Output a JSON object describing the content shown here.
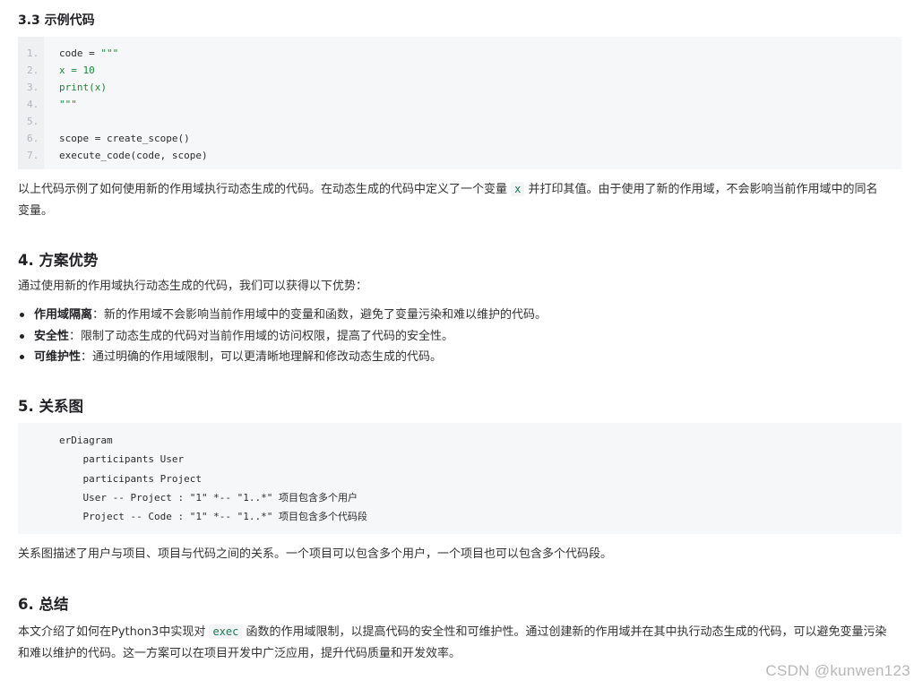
{
  "sections": {
    "s33_title": "3.3 示例代码",
    "code1": [
      {
        "n": "1.",
        "segments": [
          {
            "t": "code = ",
            "c": "plain"
          },
          {
            "t": "\"\"\"",
            "c": "str"
          }
        ]
      },
      {
        "n": "2.",
        "segments": [
          {
            "t": "x = 10",
            "c": "str"
          }
        ]
      },
      {
        "n": "3.",
        "segments": [
          {
            "t": "print(x)",
            "c": "str"
          }
        ]
      },
      {
        "n": "4.",
        "segments": [
          {
            "t": "\"\"\"",
            "c": "str"
          }
        ]
      },
      {
        "n": "5.",
        "segments": []
      },
      {
        "n": "6.",
        "segments": [
          {
            "t": "scope = create_scope()",
            "c": "plain"
          }
        ]
      },
      {
        "n": "7.",
        "segments": [
          {
            "t": "execute_code(code, scope)",
            "c": "plain"
          }
        ]
      }
    ],
    "explain_before": "以上代码示例了如何使用新的作用域执行动态生成的代码。在动态生成的代码中定义了一个变量 ",
    "explain_code": "x",
    "explain_after_line1": " 并打印其值。由于使用了新的作用域，不会影响当前作用域中的同名",
    "explain_line2": "变量。",
    "s4_title": "4. 方案优势",
    "s4_intro": "通过使用新的作用域执行动态生成的代码，我们可以获得以下优势：",
    "benefits": [
      {
        "term": "作用域隔离",
        "desc": "：新的作用域不会影响当前作用域中的变量和函数，避免了变量污染和难以维护的代码。"
      },
      {
        "term": "安全性",
        "desc": "：限制了动态生成的代码对当前作用域的访问权限，提高了代码的安全性。"
      },
      {
        "term": "可维护性",
        "desc": "：通过明确的作用域限制，可以更清晰地理解和修改动态生成的代码。"
      }
    ],
    "s5_title": "5. 关系图",
    "er_lines": [
      "erDiagram",
      "    participants User",
      "    participants Project",
      "    User -- Project : \"1\" *-- \"1..*\" 项目包含多个用户",
      "    Project -- Code : \"1\" *-- \"1..*\" 项目包含多个代码段"
    ],
    "s5_desc": "关系图描述了用户与项目、项目与代码之间的关系。一个项目可以包含多个用户，一个项目也可以包含多个代码段。",
    "s6_title": "6. 总结",
    "s6_before": "本文介绍了如何在Python3中实现对 ",
    "s6_code": "exec",
    "s6_after_line1": " 函数的作用域限制，以提高代码的安全性和可维护性。通过创建新的作用域并在其中执行动态生成的代码，可以避免变量污染",
    "s6_line2": "和难以维护的代码。这一方案可以在项目开发中广泛应用，提升代码质量和开发效率。"
  },
  "watermark": "CSDN @kunwen123"
}
